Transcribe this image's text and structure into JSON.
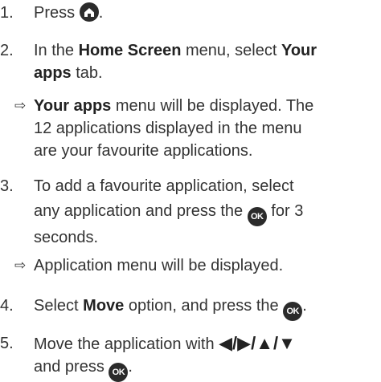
{
  "steps": [
    {
      "num": "1.",
      "text_before": "Press ",
      "icon": "home-icon",
      "text_after": "."
    },
    {
      "num": "2.",
      "line1_a": "In the ",
      "line1_b": "Home Screen",
      "line1_c": " menu, select ",
      "line1_d": "Your",
      "line2_a": "apps",
      "line2_b": " tab."
    },
    {
      "result": true,
      "arrow": "⇨",
      "line1_a": "Your apps",
      "line1_b": " menu will be displayed. The",
      "line2": "12 applications displayed in the menu",
      "line3": "are your favourite applications."
    },
    {
      "num": "3.",
      "line1": "To add a favourite application, select",
      "line2_a": "any application and press the ",
      "ok_label": "OK",
      "line2_b": " for 3",
      "line3": "seconds."
    },
    {
      "result": true,
      "arrow": "⇨",
      "line1": "Application menu will be displayed."
    },
    {
      "num": "4.",
      "text_a": "Select ",
      "text_b": "Move",
      "text_c": " option, and press the ",
      "ok_label": "OK",
      "text_d": "."
    },
    {
      "num": "5.",
      "line1_a": "Move the application with ",
      "nav_glyphs": "◀/▶/▲/▼",
      "line2_a": "and press ",
      "ok_label": "OK",
      "line2_b": "."
    }
  ]
}
